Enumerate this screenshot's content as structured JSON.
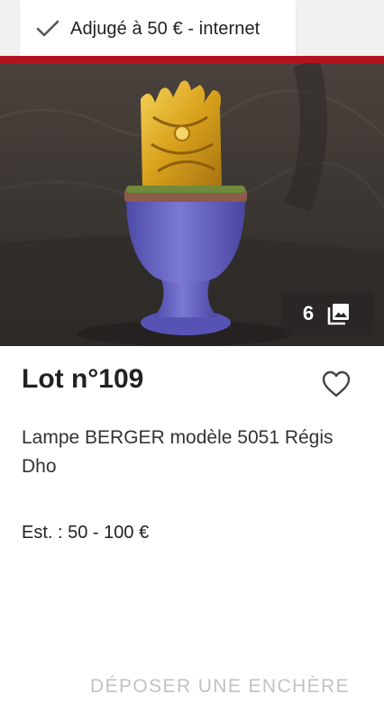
{
  "status": {
    "text": "Adjugé à 50 € - internet",
    "icon": "check-icon"
  },
  "accent_color": "#b3121f",
  "photo": {
    "count": "6",
    "icon": "gallery-icon"
  },
  "lot": {
    "title": "Lot n°109",
    "description": "Lampe BERGER modèle 5051 Régis Dho",
    "estimate": "Est. : 50 - 100 €"
  },
  "favorite_icon": "heart-outline-icon",
  "actions": {
    "bid_label": "DÉPOSER UNE ENCHÈRE"
  }
}
